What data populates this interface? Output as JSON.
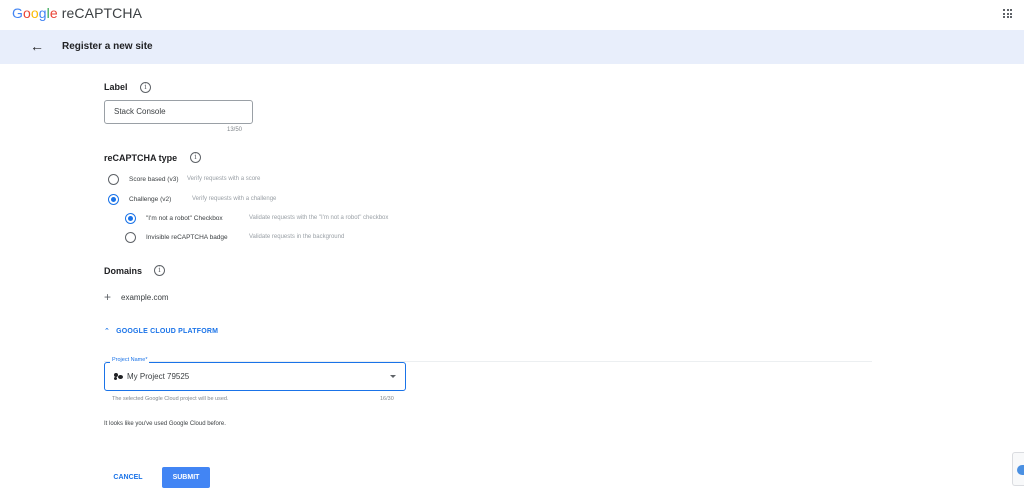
{
  "header": {
    "logo_letters": [
      "G",
      "o",
      "o",
      "g",
      "l",
      "e"
    ],
    "product": "reCAPTCHA",
    "apps_icon": "apps-grid-icon"
  },
  "subheader": {
    "back_icon": "arrow-back-icon",
    "title": "Register a new site"
  },
  "label_section": {
    "heading": "Label",
    "value": "Stack Console",
    "counter": "13/50"
  },
  "type_section": {
    "heading": "reCAPTCHA type",
    "options": [
      {
        "label": "Score based (v3)",
        "description": "Verify requests with a score",
        "selected": false
      },
      {
        "label": "Challenge (v2)",
        "description": "Verify requests with a challenge",
        "selected": true
      }
    ],
    "suboptions": [
      {
        "label": "\"I'm not a robot\" Checkbox",
        "description": "Validate requests with the \"I'm not a robot\" checkbox",
        "selected": true
      },
      {
        "label": "Invisible reCAPTCHA badge",
        "description": "Validate requests in the background",
        "selected": false
      }
    ]
  },
  "domains_section": {
    "heading": "Domains",
    "add_icon": "plus-icon",
    "domain": "example.com"
  },
  "gcp_section": {
    "toggle_label": "GOOGLE CLOUD PLATFORM",
    "field_label": "Project Name*",
    "project_value": "My Project 79525",
    "hint": "The selected Google Cloud project will be used.",
    "counter": "16/30",
    "note": "It looks like you've used Google Cloud before."
  },
  "actions": {
    "cancel": "CANCEL",
    "submit": "SUBMIT"
  },
  "colors": {
    "accent": "#1a73e8",
    "submit_bg": "#4285f4",
    "subheader_bg": "#e8eefb"
  }
}
